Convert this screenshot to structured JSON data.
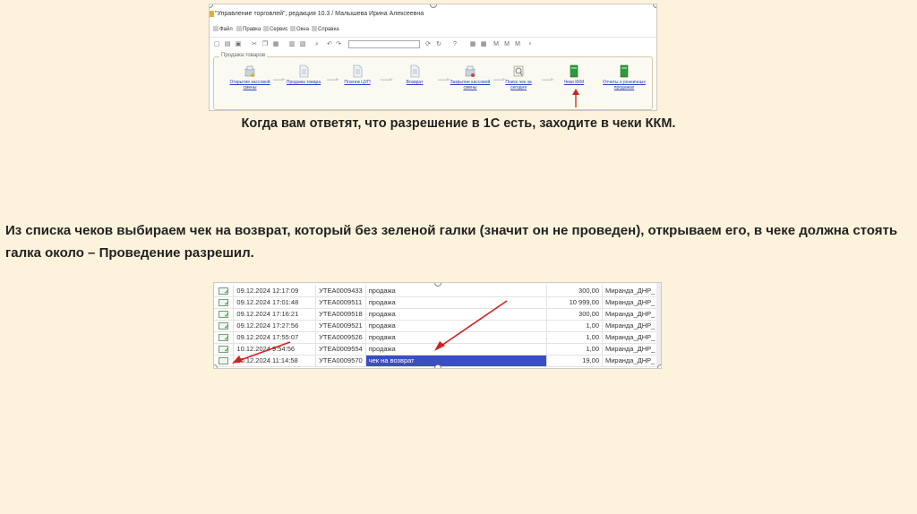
{
  "window": {
    "title": "\"Управление торговлей\", редакция 10.3 / Малышева Ирина Алексеевна"
  },
  "menu": [
    "Файл",
    "Правка",
    "Сервис",
    "Окна",
    "Справка"
  ],
  "section": {
    "title": "Продажа товаров",
    "operations": [
      {
        "label": "Открытие кассовой смены",
        "icon": "register-open-icon"
      },
      {
        "label": "Продажа товара",
        "icon": "document-icon"
      },
      {
        "label": "Платеж ЦУП",
        "icon": "document-icon"
      },
      {
        "label": "Возврат",
        "icon": "document-icon"
      },
      {
        "label": "Закрытие кассовой смены",
        "icon": "register-close-icon"
      },
      {
        "label": "Поиск чек за сегодня",
        "icon": "search-check-icon"
      },
      {
        "label": "Чеки ККМ",
        "icon": "green-book-icon"
      },
      {
        "label": "Отчеты о розничных продажах",
        "icon": "green-book-icon"
      }
    ]
  },
  "caption1": "Когда вам ответят, что разрешение в 1С есть, заходите в чеки ККМ.",
  "caption2": "Из списка чеков выбираем чек на возврат, который без зеленой галки (значит он не проведен), открываем его, в чеке должна стоять галка около – Проведение разрешил.",
  "checks": [
    {
      "date": "09.12.2024 12:17:09",
      "number": "УТЕА0009433",
      "type": "продажа",
      "sum": "300,00",
      "shop": "Миранда_ДНР_",
      "posted": true
    },
    {
      "date": "09.12.2024 17:01:48",
      "number": "УТЕА0009511",
      "type": "продажа",
      "sum": "10 999,00",
      "shop": "Миранда_ДНР_",
      "posted": true
    },
    {
      "date": "09.12.2024 17:16:21",
      "number": "УТЕА0009518",
      "type": "продажа",
      "sum": "300,00",
      "shop": "Миранда_ДНР_",
      "posted": true
    },
    {
      "date": "09.12.2024 17:27:56",
      "number": "УТЕА0009521",
      "type": "продажа",
      "sum": "1,00",
      "shop": "Миранда_ДНР_",
      "posted": true
    },
    {
      "date": "09.12.2024 17:55:07",
      "number": "УТЕА0009526",
      "type": "продажа",
      "sum": "1,00",
      "shop": "Миранда_ДНР_",
      "posted": true
    },
    {
      "date": "10.12.2024 9:54:56",
      "number": "УТЕА0009554",
      "type": "продажа",
      "sum": "1,00",
      "shop": "Миранда_ДНР_",
      "posted": true
    },
    {
      "date": "10.12.2024 11:14:58",
      "number": "УТЕА0009570",
      "type": "чек на возврат",
      "sum": "19,00",
      "shop": "Миранда_ДНР_",
      "posted": false,
      "selected": true
    }
  ],
  "colors": {
    "background": "#fdf3dc",
    "selection": "#3c4fbf",
    "arrow": "#d42020",
    "link": "#2a3fbf"
  }
}
